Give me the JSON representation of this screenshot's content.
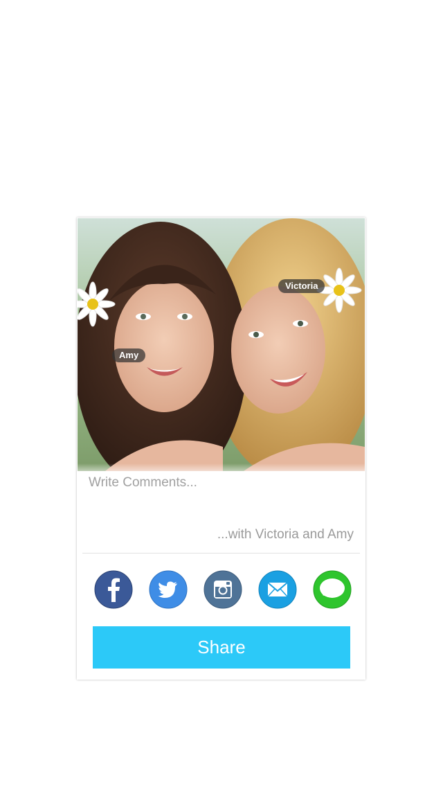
{
  "photo": {
    "tags": {
      "victoria": "Victoria",
      "amy": "Amy"
    }
  },
  "comment": {
    "placeholder": "Write Comments...",
    "with_text": "...with Victoria and Amy"
  },
  "share_targets": {
    "facebook": {
      "icon": "facebook-icon",
      "color": "#3b5998"
    },
    "twitter": {
      "icon": "twitter-icon",
      "color": "#3f8de6"
    },
    "instagram": {
      "icon": "instagram-icon",
      "color": "#4f7397"
    },
    "mail": {
      "icon": "mail-icon",
      "color": "#1aa0e2"
    },
    "messages": {
      "icon": "messages-icon",
      "color": "#2ec52d"
    }
  },
  "share_button": {
    "label": "Share",
    "color": "#2cc9f8"
  }
}
